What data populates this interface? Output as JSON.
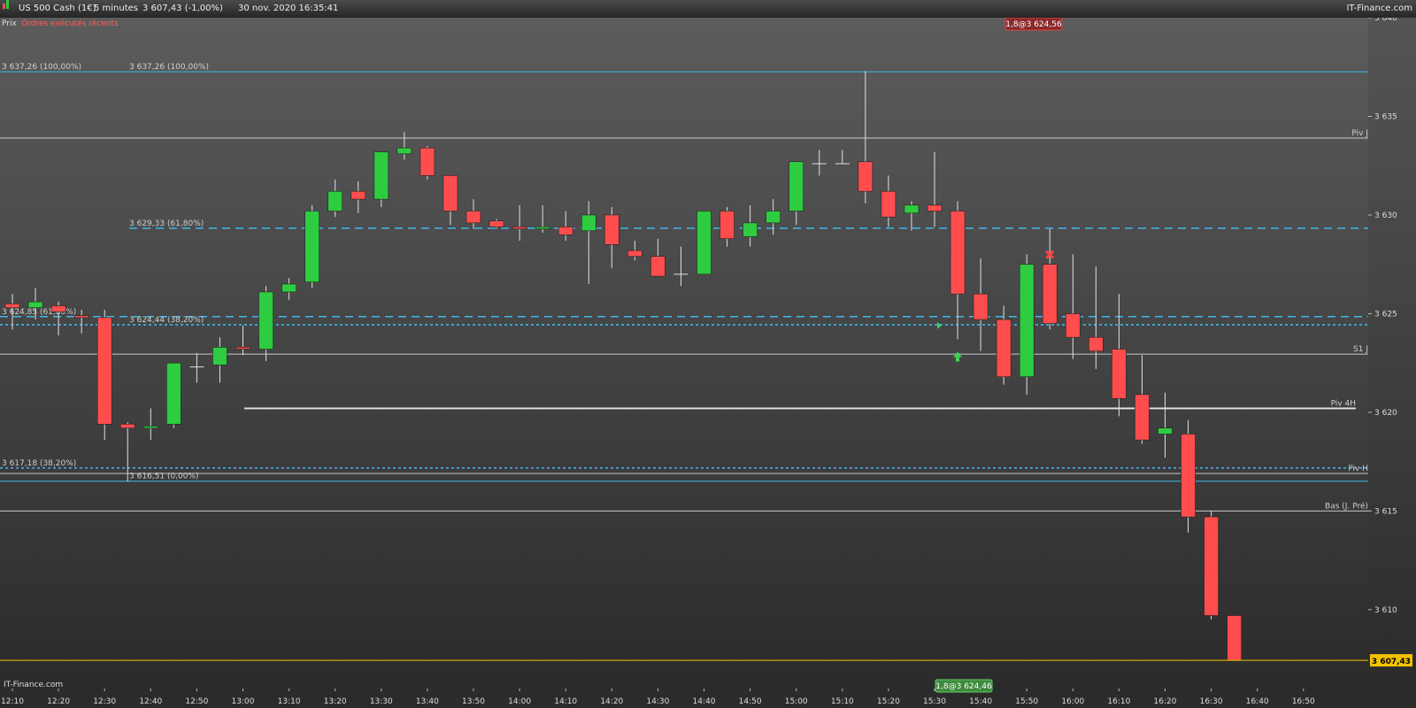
{
  "header": {
    "instrument": "US 500 Cash (1€)",
    "timeframe": "5 minutes",
    "quote": "3 607,43 (-1,00%)",
    "datetime": "30 nov. 2020 16:35:41",
    "brand": "IT-Finance.com"
  },
  "chart_labels": {
    "price_tab": "Prix",
    "orders_tab": "Ordres exécutés récents",
    "watermark": "IT-Finance.com",
    "top_order_badge": "1,8@3 624,56",
    "bottom_order_badge": "1,8@3 624,46",
    "last_price": "3 607,43"
  },
  "colors": {
    "up": "#2ecc40",
    "down": "#ff4d4d",
    "fib": "#3fb8e8",
    "last_price": "#f2c200",
    "order_badge_red": "#cc3333",
    "order_badge_green": "#2e8b2e"
  },
  "chart_data": {
    "type": "candlestick",
    "ylim": [
      3606,
      3640
    ],
    "x_ticks": [
      "12:10",
      "12:20",
      "12:30",
      "12:40",
      "12:50",
      "13:00",
      "13:10",
      "13:20",
      "13:30",
      "13:40",
      "13:50",
      "14:00",
      "14:10",
      "14:20",
      "14:30",
      "14:40",
      "14:50",
      "15:00",
      "15:10",
      "15:20",
      "15:30",
      "15:40",
      "15:50",
      "16:00",
      "16:10",
      "16:20",
      "16:30",
      "16:40",
      "16:50"
    ],
    "y_ticks": [
      {
        "v": 3640,
        "label": "3 640"
      },
      {
        "v": 3635,
        "label": "3 635"
      },
      {
        "v": 3630,
        "label": "3 630"
      },
      {
        "v": 3625,
        "label": "3 625"
      },
      {
        "v": 3620,
        "label": "3 620"
      },
      {
        "v": 3615,
        "label": "3 615"
      },
      {
        "v": 3610,
        "label": "3 610"
      }
    ],
    "candles": [
      {
        "t": "12:10",
        "o": 3625.5,
        "h": 3626.0,
        "l": 3624.2,
        "c": 3625.3
      },
      {
        "t": "12:15",
        "o": 3625.3,
        "h": 3626.3,
        "l": 3624.7,
        "c": 3625.6
      },
      {
        "t": "12:20",
        "o": 3625.4,
        "h": 3625.6,
        "l": 3623.9,
        "c": 3625.1
      },
      {
        "t": "12:25",
        "o": 3624.9,
        "h": 3625.2,
        "l": 3624.0,
        "c": 3624.8
      },
      {
        "t": "12:30",
        "o": 3624.8,
        "h": 3625.2,
        "l": 3618.6,
        "c": 3619.4
      },
      {
        "t": "12:35",
        "o": 3619.4,
        "h": 3619.5,
        "l": 3616.5,
        "c": 3619.2
      },
      {
        "t": "12:40",
        "o": 3619.2,
        "h": 3620.2,
        "l": 3618.6,
        "c": 3619.3
      },
      {
        "t": "12:45",
        "o": 3619.4,
        "h": 3622.5,
        "l": 3619.2,
        "c": 3622.5
      },
      {
        "t": "12:50",
        "o": 3622.3,
        "h": 3623.0,
        "l": 3621.5,
        "c": 3622.3
      },
      {
        "t": "12:55",
        "o": 3622.4,
        "h": 3623.8,
        "l": 3621.5,
        "c": 3623.3
      },
      {
        "t": "13:00",
        "o": 3623.3,
        "h": 3624.4,
        "l": 3622.9,
        "c": 3623.2
      },
      {
        "t": "13:05",
        "o": 3623.2,
        "h": 3626.4,
        "l": 3622.6,
        "c": 3626.1
      },
      {
        "t": "13:10",
        "o": 3626.1,
        "h": 3626.8,
        "l": 3625.7,
        "c": 3626.5
      },
      {
        "t": "13:15",
        "o": 3626.6,
        "h": 3630.5,
        "l": 3626.3,
        "c": 3630.2
      },
      {
        "t": "13:20",
        "o": 3630.2,
        "h": 3631.8,
        "l": 3629.9,
        "c": 3631.2
      },
      {
        "t": "13:25",
        "o": 3631.2,
        "h": 3631.7,
        "l": 3630.1,
        "c": 3630.8
      },
      {
        "t": "13:30",
        "o": 3630.8,
        "h": 3633.2,
        "l": 3630.4,
        "c": 3633.2
      },
      {
        "t": "13:35",
        "o": 3633.1,
        "h": 3634.2,
        "l": 3632.8,
        "c": 3633.4
      },
      {
        "t": "13:40",
        "o": 3633.4,
        "h": 3633.5,
        "l": 3631.8,
        "c": 3632.0
      },
      {
        "t": "13:45",
        "o": 3632.0,
        "h": 3632.0,
        "l": 3629.5,
        "c": 3630.2
      },
      {
        "t": "13:50",
        "o": 3630.2,
        "h": 3630.8,
        "l": 3629.3,
        "c": 3629.6
      },
      {
        "t": "13:55",
        "o": 3629.7,
        "h": 3629.8,
        "l": 3629.3,
        "c": 3629.4
      },
      {
        "t": "14:00",
        "o": 3629.4,
        "h": 3630.5,
        "l": 3628.7,
        "c": 3629.3
      },
      {
        "t": "14:05",
        "o": 3629.3,
        "h": 3630.5,
        "l": 3629.1,
        "c": 3629.4
      },
      {
        "t": "14:10",
        "o": 3629.4,
        "h": 3630.2,
        "l": 3628.7,
        "c": 3629.0
      },
      {
        "t": "14:15",
        "o": 3629.2,
        "h": 3630.7,
        "l": 3626.5,
        "c": 3630.0
      },
      {
        "t": "14:20",
        "o": 3630.0,
        "h": 3630.4,
        "l": 3627.3,
        "c": 3628.5
      },
      {
        "t": "14:25",
        "o": 3628.2,
        "h": 3628.7,
        "l": 3627.7,
        "c": 3627.9
      },
      {
        "t": "14:30",
        "o": 3627.9,
        "h": 3628.8,
        "l": 3626.9,
        "c": 3626.9
      },
      {
        "t": "14:35",
        "o": 3627.0,
        "h": 3628.4,
        "l": 3626.4,
        "c": 3627.0
      },
      {
        "t": "14:40",
        "o": 3627.0,
        "h": 3630.2,
        "l": 3627.0,
        "c": 3630.2
      },
      {
        "t": "14:45",
        "o": 3630.2,
        "h": 3630.4,
        "l": 3628.4,
        "c": 3628.8
      },
      {
        "t": "14:50",
        "o": 3628.9,
        "h": 3630.5,
        "l": 3628.4,
        "c": 3629.6
      },
      {
        "t": "14:55",
        "o": 3629.6,
        "h": 3630.8,
        "l": 3629.0,
        "c": 3630.2
      },
      {
        "t": "15:00",
        "o": 3630.2,
        "h": 3632.7,
        "l": 3629.5,
        "c": 3632.7
      },
      {
        "t": "15:05",
        "o": 3632.6,
        "h": 3633.3,
        "l": 3632.0,
        "c": 3632.6
      },
      {
        "t": "15:10",
        "o": 3632.6,
        "h": 3633.3,
        "l": 3632.6,
        "c": 3632.6
      },
      {
        "t": "15:15",
        "o": 3632.7,
        "h": 3637.3,
        "l": 3630.6,
        "c": 3631.2
      },
      {
        "t": "15:20",
        "o": 3631.2,
        "h": 3632.0,
        "l": 3629.4,
        "c": 3629.9
      },
      {
        "t": "15:25",
        "o": 3630.1,
        "h": 3630.7,
        "l": 3629.2,
        "c": 3630.5
      },
      {
        "t": "15:30",
        "o": 3630.5,
        "h": 3633.2,
        "l": 3629.4,
        "c": 3630.2
      },
      {
        "t": "15:35",
        "o": 3630.2,
        "h": 3630.7,
        "l": 3623.7,
        "c": 3626.0
      },
      {
        "t": "15:40",
        "o": 3626.0,
        "h": 3627.8,
        "l": 3623.1,
        "c": 3624.7
      },
      {
        "t": "15:45",
        "o": 3624.7,
        "h": 3625.4,
        "l": 3621.4,
        "c": 3621.8
      },
      {
        "t": "15:50",
        "o": 3621.8,
        "h": 3628.0,
        "l": 3620.9,
        "c": 3627.5
      },
      {
        "t": "15:55",
        "o": 3627.5,
        "h": 3629.3,
        "l": 3624.2,
        "c": 3624.5
      },
      {
        "t": "16:00",
        "o": 3625.0,
        "h": 3628.0,
        "l": 3622.7,
        "c": 3623.8
      },
      {
        "t": "16:05",
        "o": 3623.8,
        "h": 3627.4,
        "l": 3622.2,
        "c": 3623.1
      },
      {
        "t": "16:10",
        "o": 3623.2,
        "h": 3626.0,
        "l": 3619.8,
        "c": 3620.7
      },
      {
        "t": "16:15",
        "o": 3620.9,
        "h": 3622.9,
        "l": 3618.4,
        "c": 3618.6
      },
      {
        "t": "16:20",
        "o": 3618.9,
        "h": 3621.0,
        "l": 3617.7,
        "c": 3619.2
      },
      {
        "t": "16:25",
        "o": 3618.9,
        "h": 3619.6,
        "l": 3613.9,
        "c": 3614.7
      },
      {
        "t": "16:30",
        "o": 3614.7,
        "h": 3615.0,
        "l": 3609.5,
        "c": 3609.7
      },
      {
        "t": "16:35",
        "o": 3609.7,
        "h": 3609.7,
        "l": 3607.4,
        "c": 3607.43
      }
    ],
    "levels": [
      {
        "v": 3637.26,
        "style": "fib-solid",
        "label": "3 637,26 (100,00%)"
      },
      {
        "v": 3633.9,
        "style": "pivot",
        "label": "Piv J"
      },
      {
        "v": 3629.33,
        "style": "fib-dash",
        "label": "3 629,33 (61,80%)"
      },
      {
        "v": 3624.85,
        "style": "fib-dash",
        "label": "3 624,85 (61,80%)"
      },
      {
        "v": 3624.44,
        "style": "fib-dot",
        "label": "3 624,44 (38,20%)"
      },
      {
        "v": 3622.95,
        "style": "pivot",
        "label": "S1 J"
      },
      {
        "v": 3620.2,
        "style": "pivot4h",
        "label": "Piv 4H"
      },
      {
        "v": 3617.18,
        "style": "fib-dot",
        "label": "3 617,18 (38,20%)"
      },
      {
        "v": 3616.9,
        "style": "pivot",
        "label": "Piv H"
      },
      {
        "v": 3616.51,
        "style": "fib-solid",
        "label": "3 616,51 (0,00%)"
      },
      {
        "v": 3615.0,
        "style": "pivot",
        "label": "Bas (J. Pré)"
      }
    ]
  }
}
